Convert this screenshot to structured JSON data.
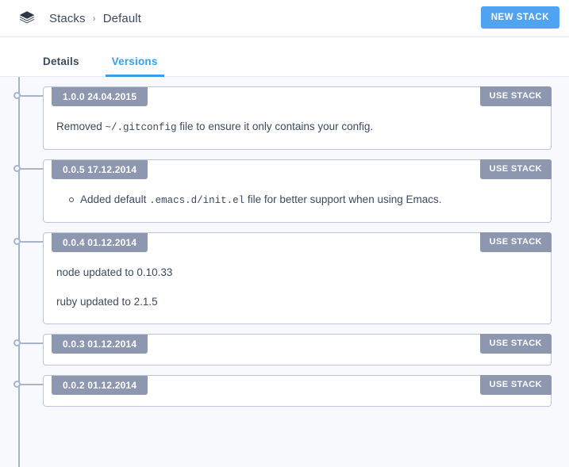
{
  "header": {
    "logo_icon": "layers-stack-icon",
    "breadcrumb": {
      "root": "Stacks",
      "separator": "›",
      "current": "Default"
    },
    "new_stack_label": "NEW STACK",
    "accent_color": "#4fa3f0"
  },
  "tabs": [
    {
      "label": "Details",
      "active": false
    },
    {
      "label": "Versions",
      "active": true
    }
  ],
  "colors": {
    "accent": "#33a0e8",
    "badge": "#8d97af",
    "rail": "#a8b4cc",
    "page_bg": "#f7f9fc",
    "card_border": "#bcc6da",
    "text": "#3c4a5e"
  },
  "versions": [
    {
      "version": "1.0.0",
      "date": "24.04.2015",
      "badge_label": "1.0.0 24.04.2015",
      "action_label": "USE STACK",
      "body_type": "paragraphs",
      "paragraphs": [
        {
          "pre": "Removed ",
          "code": "~/.gitconfig",
          "post": " file to ensure it only contains your config."
        }
      ]
    },
    {
      "version": "0.0.5",
      "date": "17.12.2014",
      "badge_label": "0.0.5 17.12.2014",
      "action_label": "USE STACK",
      "body_type": "list",
      "items": [
        {
          "pre": "Added default ",
          "code": ".emacs.d/init.el",
          "post": " file for better support when using Emacs."
        }
      ]
    },
    {
      "version": "0.0.4",
      "date": "01.12.2014",
      "badge_label": "0.0.4 01.12.2014",
      "action_label": "USE STACK",
      "body_type": "paragraphs",
      "paragraphs": [
        {
          "pre": "node updated to 0.10.33",
          "code": "",
          "post": ""
        },
        {
          "pre": "ruby updated to 2.1.5",
          "code": "",
          "post": ""
        }
      ]
    },
    {
      "version": "0.0.3",
      "date": "01.12.2014",
      "badge_label": "0.0.3 01.12.2014",
      "action_label": "USE STACK",
      "body_type": "empty",
      "paragraphs": []
    },
    {
      "version": "0.0.2",
      "date": "01.12.2014",
      "badge_label": "0.0.2 01.12.2014",
      "action_label": "USE STACK",
      "body_type": "empty",
      "paragraphs": []
    }
  ]
}
